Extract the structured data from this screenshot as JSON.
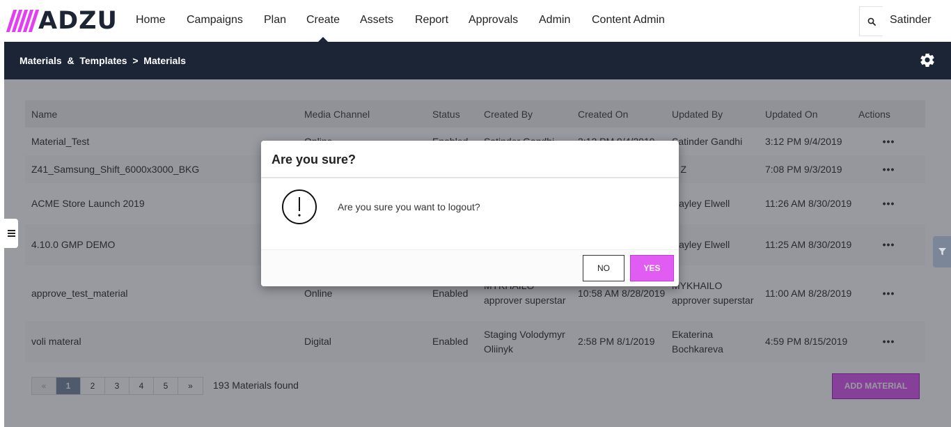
{
  "brand": {
    "name": "ADZU",
    "accent": "#e15cf2",
    "dark": "#1c2535"
  },
  "nav": {
    "items": [
      {
        "label": "Home"
      },
      {
        "label": "Campaigns"
      },
      {
        "label": "Plan"
      },
      {
        "label": "Create"
      },
      {
        "label": "Assets"
      },
      {
        "label": "Report"
      },
      {
        "label": "Approvals"
      },
      {
        "label": "Admin"
      },
      {
        "label": "Content Admin"
      }
    ],
    "active": "Create",
    "user": "Satinder"
  },
  "header": {
    "breadcrumb": "Materials  &  Templates  >  Materials"
  },
  "table": {
    "columns": [
      "Name",
      "Media Channel",
      "Status",
      "Created By",
      "Created On",
      "Updated By",
      "Updated On",
      "Actions"
    ],
    "rows": [
      {
        "name": "Material_Test",
        "channel": "Online",
        "status": "Enabled",
        "created_by": "Satinder Gandhi",
        "created_on": "3:12 PM 9/4/2019",
        "updated_by": "Satinder Gandhi",
        "updated_on": "3:12 PM 9/4/2019",
        "actions": "•••"
      },
      {
        "name": "Z41_Samsung_Shift_6000x3000_BKG",
        "channel": "",
        "status": "",
        "created_by": "",
        "created_on": "",
        "updated_by": "Z Z",
        "updated_on": "7:08 PM 9/3/2019",
        "actions": "•••"
      },
      {
        "name": "ACME Store Launch 2019",
        "channel": "",
        "status": "",
        "created_by": "",
        "created_on": "",
        "updated_by": "Hayley Elwell",
        "updated_on": "11:26 AM 8/30/2019",
        "actions": "•••"
      },
      {
        "name": "4.10.0 GMP DEMO",
        "channel": "",
        "status": "",
        "created_by": "",
        "created_on": "",
        "updated_by": "Hayley Elwell",
        "updated_on": "11:25 AM 8/30/2019",
        "actions": "•••"
      },
      {
        "name": "approve_test_material",
        "channel": "Online",
        "status": "Enabled",
        "created_by": "MYKHAILO approver superstar",
        "created_on": "10:58 AM 8/28/2019",
        "updated_by": "MYKHAILO approver superstar",
        "updated_on": "11:00 AM 8/28/2019",
        "actions": "•••"
      },
      {
        "name": "voli materal",
        "channel": "Digital",
        "status": "Enabled",
        "created_by": "Staging Volodymyr Oliinyk",
        "created_on": "2:58 PM 8/1/2019",
        "updated_by": "Ekaterina Bochkareva",
        "updated_on": "4:59 PM 8/15/2019",
        "actions": "•••"
      }
    ]
  },
  "pagination": {
    "prev": "«",
    "pages": [
      "1",
      "2",
      "3",
      "4",
      "5"
    ],
    "current": "1",
    "next": "»",
    "found": "193 Materials found"
  },
  "add_button": "ADD MATERIAL",
  "modal": {
    "title": "Are you sure?",
    "message": "Are you sure you want to logout?",
    "no": "NO",
    "yes": "YES"
  },
  "icons": [
    "search-icon",
    "gear-icon",
    "menu-icon",
    "filter-icon",
    "warning-icon"
  ]
}
